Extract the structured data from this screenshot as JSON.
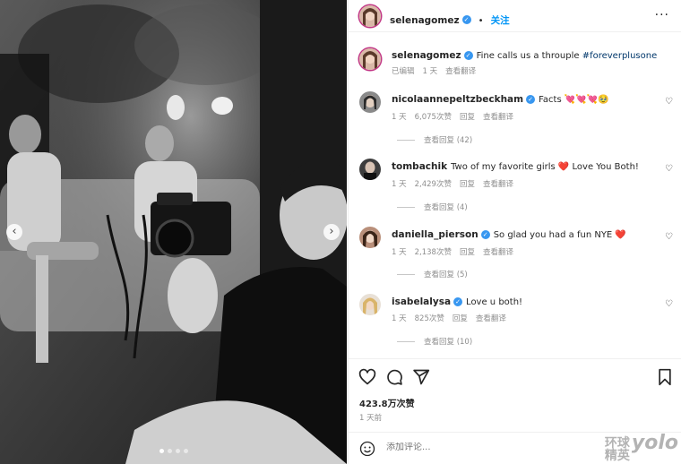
{
  "photo": {
    "carousel_prev": "‹",
    "carousel_next": "›",
    "dots_total": 4,
    "dots_active": 1
  },
  "header": {
    "username": "selenagomez",
    "follow_label": "关注",
    "more_label": "···"
  },
  "caption": {
    "username": "selenagomez",
    "text": "Fine calls us a throuple ",
    "hashtag": "#foreverplusone",
    "edited": "已编辑",
    "age": "1 天",
    "translate": "查看翻译"
  },
  "comments": [
    {
      "username": "nicolaannepeltzbeckham",
      "text": "Facts 💘💘💘🥹",
      "age": "1 天",
      "likes": "6,075次赞",
      "reply": "回复",
      "translate": "查看翻译",
      "replies": "查看回复 (42)"
    },
    {
      "username": "tombachik",
      "text": "Two of my favorite girls ❤️ Love You Both!",
      "age": "1 天",
      "likes": "2,429次赞",
      "reply": "回复",
      "translate": "查看翻译",
      "replies": "查看回复 (4)"
    },
    {
      "username": "daniella_pierson",
      "text": "So glad you had a fun NYE ❤️",
      "age": "1 天",
      "likes": "2,138次赞",
      "reply": "回复",
      "translate": "查看翻译",
      "replies": "查看回复 (5)"
    },
    {
      "username": "isabelalysa",
      "text": "Love u both!",
      "age": "1 天",
      "likes": "825次赞",
      "reply": "回复",
      "translate": "查看翻译",
      "replies": "查看回复 (10)"
    }
  ],
  "actions": {
    "likes": "423.8万次赞",
    "time": "1 天前"
  },
  "comment_box": {
    "placeholder": "添加评论..."
  },
  "watermark": {
    "line1": "环球",
    "line2": "精英",
    "yolo": "yolo"
  },
  "colors": {
    "link": "#0095f6",
    "verified": "#3897f0",
    "muted": "#8e8e8e"
  }
}
